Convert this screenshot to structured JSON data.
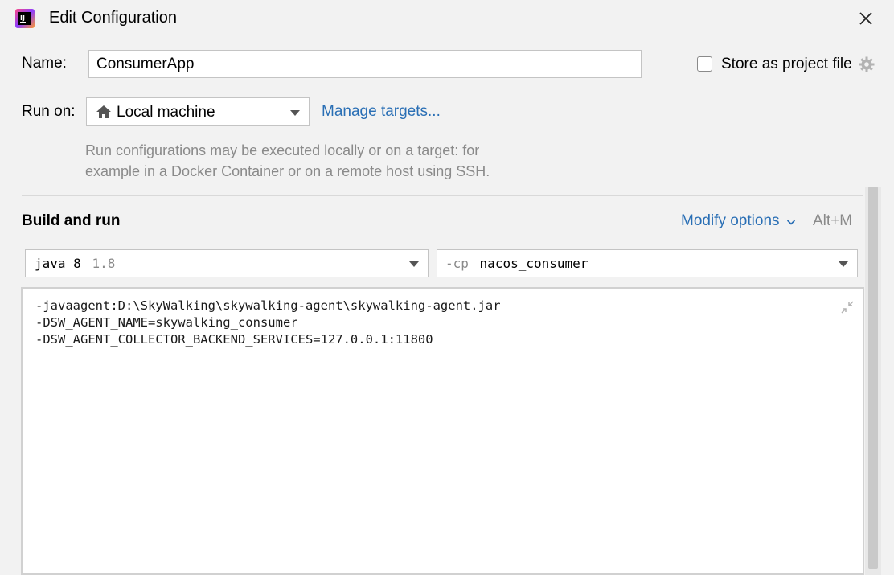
{
  "window": {
    "title": "Edit Configuration",
    "app_icon": "intellij-idea-icon",
    "close_icon": "close-icon"
  },
  "name_row": {
    "label": "Name:",
    "value": "ConsumerApp",
    "store_checkbox_label": "Store as project file",
    "store_checked": false,
    "gear_icon": "gear-icon"
  },
  "run_on": {
    "label": "Run on:",
    "selected": "Local machine",
    "selected_icon": "home-icon",
    "manage_link": "Manage targets...",
    "hint_line1": "Run configurations may be executed locally or on a target: for",
    "hint_line2": "example in a Docker Container or on a remote host using SSH."
  },
  "build_run": {
    "heading": "Build and run",
    "modify_options": "Modify options",
    "modify_shortcut": "Alt+M",
    "jdk_name": "java 8",
    "jdk_version": "1.8",
    "cp_prefix": "-cp",
    "cp_value": "nacos_consumer",
    "vm_options": [
      "-javaagent:D:\\SkyWalking\\skywalking-agent\\skywalking-agent.jar",
      "-DSW_AGENT_NAME=skywalking_consumer",
      "-DSW_AGENT_COLLECTOR_BACKEND_SERVICES=127.0.0.1:11800"
    ],
    "collapse_icon": "collapse-icon"
  },
  "colors": {
    "background": "#f2f2f2",
    "link": "#2a6fb5",
    "hint": "#8a8a8a"
  }
}
